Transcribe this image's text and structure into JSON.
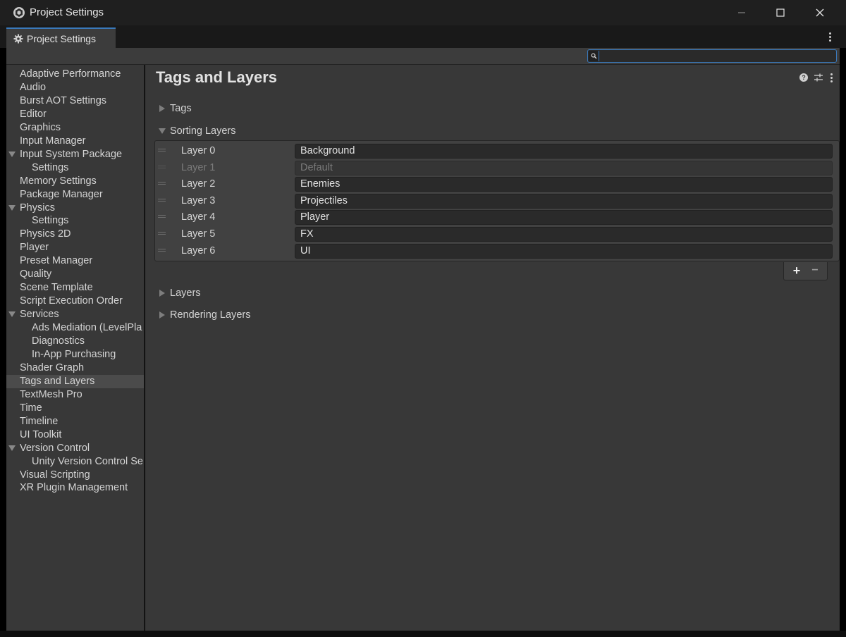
{
  "window": {
    "title": "Project Settings",
    "controls": {
      "minimize": "minimize",
      "maximize": "maximize",
      "close": "close"
    }
  },
  "tab": {
    "label": "Project Settings"
  },
  "search": {
    "value": "",
    "placeholder": ""
  },
  "sidebar": {
    "items": [
      {
        "label": "Adaptive Performance",
        "indent": 0,
        "expandable": false,
        "selected": false
      },
      {
        "label": "Audio",
        "indent": 0,
        "expandable": false,
        "selected": false
      },
      {
        "label": "Burst AOT Settings",
        "indent": 0,
        "expandable": false,
        "selected": false
      },
      {
        "label": "Editor",
        "indent": 0,
        "expandable": false,
        "selected": false
      },
      {
        "label": "Graphics",
        "indent": 0,
        "expandable": false,
        "selected": false
      },
      {
        "label": "Input Manager",
        "indent": 0,
        "expandable": false,
        "selected": false
      },
      {
        "label": "Input System Package",
        "indent": 0,
        "expandable": true,
        "selected": false
      },
      {
        "label": "Settings",
        "indent": 1,
        "expandable": false,
        "selected": false
      },
      {
        "label": "Memory Settings",
        "indent": 0,
        "expandable": false,
        "selected": false
      },
      {
        "label": "Package Manager",
        "indent": 0,
        "expandable": false,
        "selected": false
      },
      {
        "label": "Physics",
        "indent": 0,
        "expandable": true,
        "selected": false
      },
      {
        "label": "Settings",
        "indent": 1,
        "expandable": false,
        "selected": false
      },
      {
        "label": "Physics 2D",
        "indent": 0,
        "expandable": false,
        "selected": false
      },
      {
        "label": "Player",
        "indent": 0,
        "expandable": false,
        "selected": false
      },
      {
        "label": "Preset Manager",
        "indent": 0,
        "expandable": false,
        "selected": false
      },
      {
        "label": "Quality",
        "indent": 0,
        "expandable": false,
        "selected": false
      },
      {
        "label": "Scene Template",
        "indent": 0,
        "expandable": false,
        "selected": false
      },
      {
        "label": "Script Execution Order",
        "indent": 0,
        "expandable": false,
        "selected": false
      },
      {
        "label": "Services",
        "indent": 0,
        "expandable": true,
        "selected": false
      },
      {
        "label": "Ads Mediation (LevelPla",
        "indent": 1,
        "expandable": false,
        "selected": false
      },
      {
        "label": "Diagnostics",
        "indent": 1,
        "expandable": false,
        "selected": false
      },
      {
        "label": "In-App Purchasing",
        "indent": 1,
        "expandable": false,
        "selected": false
      },
      {
        "label": "Shader Graph",
        "indent": 0,
        "expandable": false,
        "selected": false
      },
      {
        "label": "Tags and Layers",
        "indent": 0,
        "expandable": false,
        "selected": true
      },
      {
        "label": "TextMesh Pro",
        "indent": 0,
        "expandable": false,
        "selected": false
      },
      {
        "label": "Time",
        "indent": 0,
        "expandable": false,
        "selected": false
      },
      {
        "label": "Timeline",
        "indent": 0,
        "expandable": false,
        "selected": false
      },
      {
        "label": "UI Toolkit",
        "indent": 0,
        "expandable": false,
        "selected": false
      },
      {
        "label": "Version Control",
        "indent": 0,
        "expandable": true,
        "selected": false
      },
      {
        "label": "Unity Version Control Se",
        "indent": 1,
        "expandable": false,
        "selected": false
      },
      {
        "label": "Visual Scripting",
        "indent": 0,
        "expandable": false,
        "selected": false
      },
      {
        "label": "XR Plugin Management",
        "indent": 0,
        "expandable": false,
        "selected": false
      }
    ]
  },
  "main": {
    "title": "Tags and Layers",
    "sections": {
      "tags": {
        "label": "Tags",
        "expanded": false
      },
      "sorting_layers": {
        "label": "Sorting Layers",
        "expanded": true
      },
      "layers": {
        "label": "Layers",
        "expanded": false
      },
      "rendering_layers": {
        "label": "Rendering Layers",
        "expanded": false
      }
    },
    "sorting_layers": [
      {
        "label": "Layer 0",
        "value": "Background",
        "disabled": false
      },
      {
        "label": "Layer 1",
        "value": "Default",
        "disabled": true
      },
      {
        "label": "Layer 2",
        "value": "Enemies",
        "disabled": false
      },
      {
        "label": "Layer 3",
        "value": "Projectiles",
        "disabled": false
      },
      {
        "label": "Layer 4",
        "value": "Player",
        "disabled": false
      },
      {
        "label": "Layer 5",
        "value": "FX",
        "disabled": false
      },
      {
        "label": "Layer 6",
        "value": "UI",
        "disabled": false
      }
    ],
    "list_buttons": {
      "add": "+",
      "remove": "−"
    },
    "help_glyph": "?"
  },
  "colors": {
    "accent": "#3a79bb",
    "panel": "#383838",
    "field": "#2a2a2a",
    "selected": "#4b4b4b",
    "titlebar": "#1f1f1f"
  }
}
